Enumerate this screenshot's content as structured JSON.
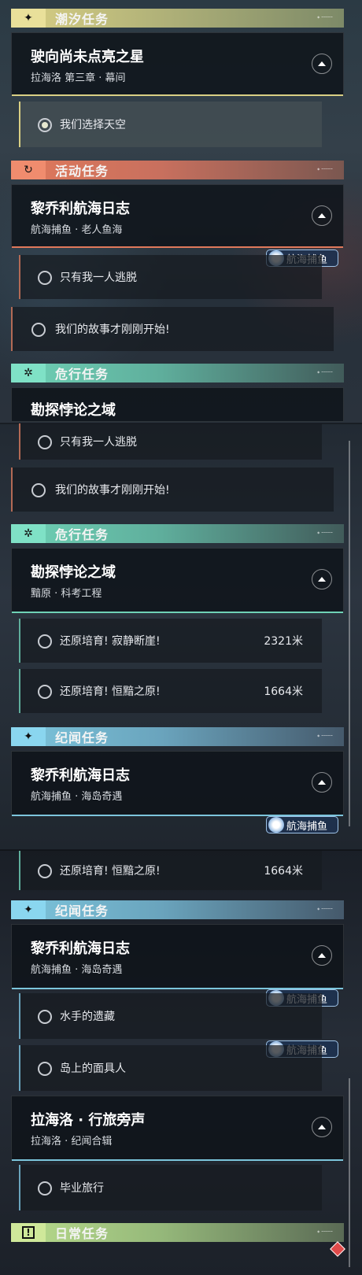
{
  "sections": {
    "tide": {
      "title": "潮汐任务",
      "icon": "sparkle-icon",
      "color": "#d9cf84"
    },
    "event": {
      "title": "活动任务",
      "icon": "refresh-icon",
      "color": "#e0795b"
    },
    "danger": {
      "title": "危行任务",
      "icon": "gear-icon",
      "color": "#6fd2b6"
    },
    "chronicle": {
      "title": "纪闻任务",
      "icon": "sparkle-icon",
      "color": "#7cc5dc"
    },
    "daily": {
      "title": "日常任务",
      "icon": "exclamation-icon",
      "color": "#b9dc8c"
    }
  },
  "quests": {
    "star": {
      "title": "驶向尚未点亮之星",
      "subtitle": "拉海洛 第三章 · 幕间"
    },
    "voyage_old_sea": {
      "title": "黎乔利航海日志",
      "subtitle": "航海捕鱼 · 老人鱼海"
    },
    "paradox": {
      "title": "勘探悖论之域",
      "subtitle": "黯原 · 科考工程"
    },
    "voyage_island": {
      "title": "黎乔利航海日志",
      "subtitle": "航海捕鱼 · 海岛奇遇"
    },
    "laheluo": {
      "title": "拉海洛 · 行旅旁声",
      "subtitle": "拉海洛 · 纪闻合辑"
    }
  },
  "objectives": {
    "sky": "我们选择天空",
    "escape": "只有我一人逃脱",
    "story": "我们的故事才刚刚开始!",
    "silent_cliff": "还原培育! 寂静断崖!",
    "dark_plain": "还原培育! 恒黯之原!",
    "sailor": "水手的遗藏",
    "mask": "岛上的面具人",
    "grad": "毕业旅行"
  },
  "distances": {
    "silent_cliff": "2321米",
    "dark_plain": "1664米"
  },
  "badge": {
    "label": "航海捕鱼",
    "icon": "fishing-icon"
  },
  "partial": {
    "paradox_title": "勘探悖论之域"
  }
}
